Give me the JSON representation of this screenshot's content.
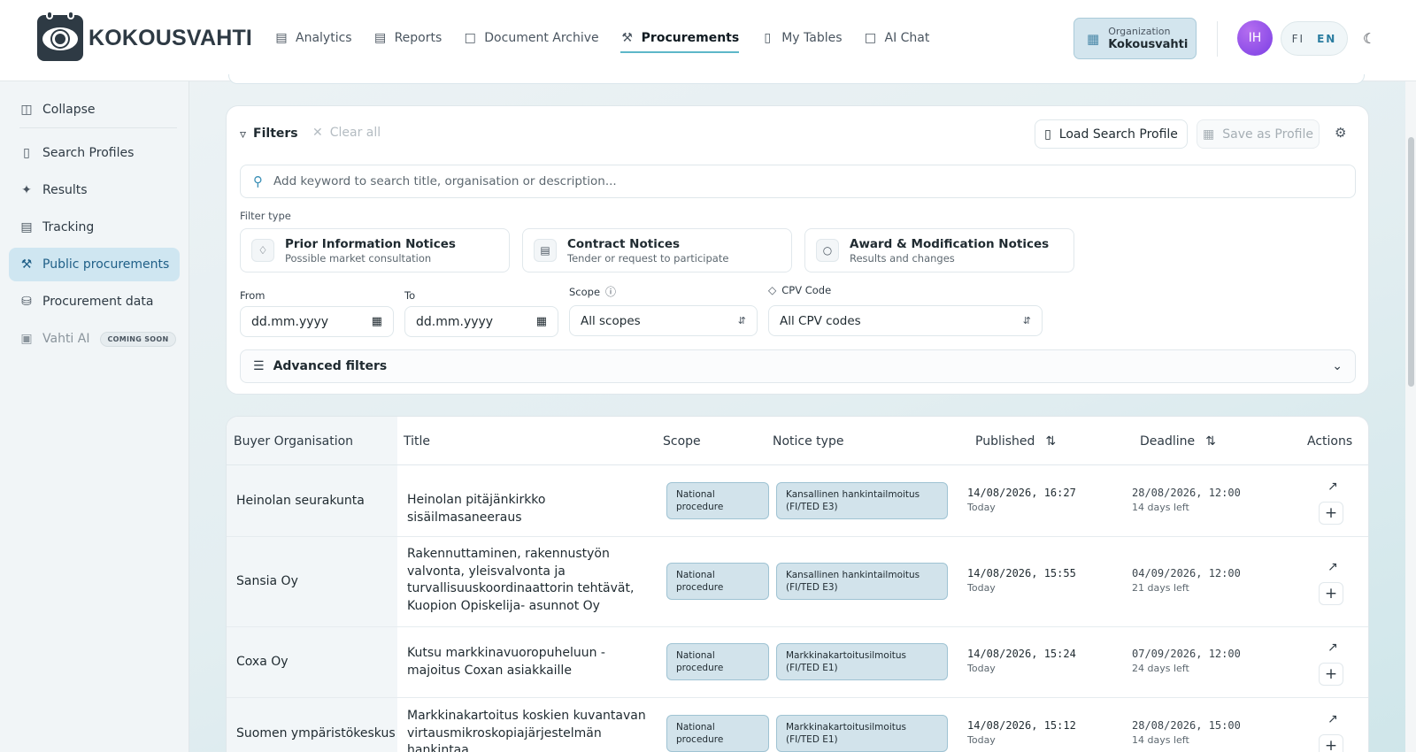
{
  "brand": {
    "name": "KOKOUSVAHTI"
  },
  "nav": {
    "items": [
      {
        "label": "Analytics",
        "icon": "bar-chart-icon"
      },
      {
        "label": "Reports",
        "icon": "document-icon"
      },
      {
        "label": "Document Archive",
        "icon": "folder-icon"
      },
      {
        "label": "Procurements",
        "icon": "gavel-icon",
        "active": true
      },
      {
        "label": "My Tables",
        "icon": "bookmark-icon"
      },
      {
        "label": "AI Chat",
        "icon": "chat-icon"
      }
    ]
  },
  "org": {
    "label": "Organization",
    "value": "Kokousvahti"
  },
  "user": {
    "initials": "IH"
  },
  "lang": {
    "fi": "FI",
    "en": "EN",
    "active": "EN"
  },
  "sidebar": {
    "collapse": "Collapse",
    "items": [
      {
        "label": "Search Profiles",
        "icon": "bookmark-icon"
      },
      {
        "label": "Results",
        "icon": "sparkle-icon"
      },
      {
        "label": "Tracking",
        "icon": "kanban-icon"
      },
      {
        "label": "Public procurements",
        "icon": "gavel-icon",
        "active": true
      },
      {
        "label": "Procurement data",
        "icon": "database-icon"
      },
      {
        "label": "Vahti AI",
        "icon": "bot-icon",
        "badge": "COMING SOON",
        "disabled": true
      }
    ]
  },
  "filters": {
    "title": "Filters",
    "clear": "Clear all",
    "load_profile": "Load Search Profile",
    "save_profile": "Save as Profile",
    "search_placeholder": "Add keyword to search title, organisation or description...",
    "filter_type_label": "Filter type",
    "types": [
      {
        "title": "Prior Information Notices",
        "subtitle": "Possible market consultation",
        "icon": "bell-icon"
      },
      {
        "title": "Contract Notices",
        "subtitle": "Tender or request to participate",
        "icon": "scroll-icon"
      },
      {
        "title": "Award & Modification Notices",
        "subtitle": "Results and changes",
        "icon": "award-icon"
      }
    ],
    "from_label": "From",
    "to_label": "To",
    "date_placeholder": "dd.mm.yyyy",
    "scope_label": "Scope",
    "scope_value": "All scopes",
    "cpv_label": "CPV Code",
    "cpv_value": "All CPV codes",
    "advanced": "Advanced filters"
  },
  "table": {
    "headers": {
      "buyer": "Buyer Organisation",
      "title": "Title",
      "scope": "Scope",
      "notice_type": "Notice type",
      "published": "Published",
      "deadline": "Deadline",
      "actions": "Actions"
    },
    "rows": [
      {
        "buyer": "Heinolan seurakunta",
        "title": "Heinolan pitäjänkirkko sisäilmasaneeraus",
        "scope": "National procedure",
        "notice": "Kansallinen hankintailmoitus (FI/TED E3)",
        "published": "14/08/2026, 16:27",
        "published_rel": "Today",
        "deadline": "28/08/2026, 12:00",
        "deadline_rel": "14 days left"
      },
      {
        "buyer": "Sansia Oy",
        "title": "Rakennuttaminen, rakennustyön valvonta, yleisvalvonta ja turvallisuuskoordinaattorin tehtävät, Kuopion Opiskelija- asunnot Oy",
        "scope": "National procedure",
        "notice": "Kansallinen hankintailmoitus (FI/TED E3)",
        "published": "14/08/2026, 15:55",
        "published_rel": "Today",
        "deadline": "04/09/2026, 12:00",
        "deadline_rel": "21 days left"
      },
      {
        "buyer": "Coxa Oy",
        "title": "Kutsu markkinavuoropuheluun - majoitus Coxan asiakkaille",
        "scope": "National procedure",
        "notice": "Markkinakartoitusilmoitus (FI/TED E1)",
        "published": "14/08/2026, 15:24",
        "published_rel": "Today",
        "deadline": "07/09/2026, 12:00",
        "deadline_rel": "24 days left"
      },
      {
        "buyer": "Suomen ympäristökeskus",
        "title": "Markkinakartoitus koskien kuvantavan virtausmikroskopiajärjestelmän hankintaa",
        "scope": "National procedure",
        "notice": "Markkinakartoitusilmoitus (FI/TED E1)",
        "published": "14/08/2026, 15:12",
        "published_rel": "Today",
        "deadline": "28/08/2026, 15:00",
        "deadline_rel": "14 days left"
      }
    ]
  }
}
